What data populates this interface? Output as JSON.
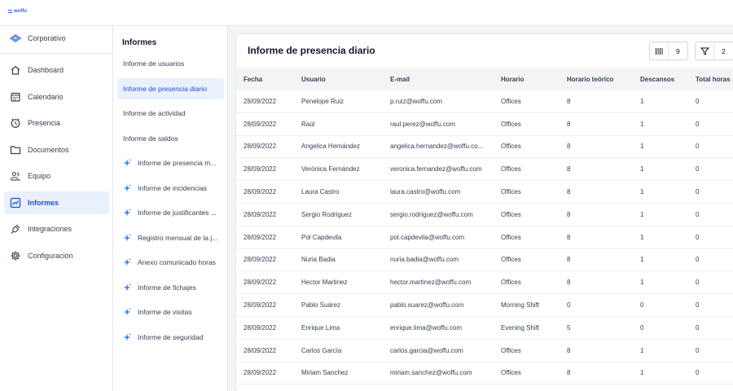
{
  "app": {
    "logo_text": "woffu"
  },
  "company": {
    "name": "Corporativo"
  },
  "nav": [
    {
      "label": "Dashboard",
      "icon": "home-icon"
    },
    {
      "label": "Calendario",
      "icon": "calendar-icon"
    },
    {
      "label": "Presencia",
      "icon": "clock-icon"
    },
    {
      "label": "Documentos",
      "icon": "folder-icon"
    },
    {
      "label": "Equipo",
      "icon": "team-icon"
    },
    {
      "label": "Informes",
      "icon": "chart-icon",
      "active": true
    },
    {
      "label": "Integraciones",
      "icon": "plug-icon"
    },
    {
      "label": "Configuración",
      "icon": "gear-icon"
    }
  ],
  "subnav": {
    "title": "Informes",
    "items": [
      {
        "label": "Informe de usuarios",
        "premium": false
      },
      {
        "label": "Informe de presencia diario",
        "premium": false,
        "active": true
      },
      {
        "label": "Informe de actividad",
        "premium": false
      },
      {
        "label": "Informe de saldos",
        "premium": false
      },
      {
        "label": "Informe de presencia m...",
        "premium": true
      },
      {
        "label": "Informe de incidencias",
        "premium": true
      },
      {
        "label": "Informe de justificantes ...",
        "premium": true
      },
      {
        "label": "Registro mensual de la j...",
        "premium": true
      },
      {
        "label": "Anexo comunicado horas",
        "premium": true
      },
      {
        "label": "Informe de fichajes",
        "premium": true
      },
      {
        "label": "Informe de visitas",
        "premium": true
      },
      {
        "label": "Informe de seguridad",
        "premium": true
      }
    ]
  },
  "report": {
    "title": "Informe de presencia diario",
    "columns_button_count": "9",
    "filter_button_count": "2"
  },
  "table": {
    "columns": [
      "Fecha",
      "Usuario",
      "E-mail",
      "Horario",
      "Horario teórico",
      "Descansos",
      "Total horas"
    ],
    "rows": [
      [
        "28/09/2022",
        "Penelope Ruiz",
        "p.ruiz@woffu.com",
        "Offices",
        "8",
        "1",
        "0"
      ],
      [
        "28/09/2022",
        "Raúl",
        "raul.perez@woffu.com",
        "Offices",
        "8",
        "1",
        "0"
      ],
      [
        "28/09/2022",
        "Angelica Hernández",
        "angelica.hernandez@woffu.co...",
        "Offices",
        "8",
        "1",
        "0"
      ],
      [
        "28/09/2022",
        "Verónica Fernández",
        "veronica.fernandez@woffu.com",
        "Offices",
        "8",
        "1",
        "0"
      ],
      [
        "28/09/2022",
        "Laura Castro",
        "laura.castro@woffu.com",
        "Offices",
        "8",
        "1",
        "0"
      ],
      [
        "28/09/2022",
        "Sergio Rodriguez",
        "sergio.rodriguez@woffu.com",
        "Offices",
        "8",
        "1",
        "0"
      ],
      [
        "28/09/2022",
        "Pol Capdevila",
        "pol.capdevila@woffu.com",
        "Offices",
        "8",
        "1",
        "0"
      ],
      [
        "28/09/2022",
        "Nuria Badia",
        "nuria.badia@woffu.com",
        "Offices",
        "8",
        "1",
        "0"
      ],
      [
        "28/09/2022",
        "Hector Martinez",
        "hector.martinez@woffu.com",
        "Offices",
        "8",
        "1",
        "0"
      ],
      [
        "28/09/2022",
        "Pablo Suárez",
        "pablo.suarez@woffu.com",
        "Morning Shift",
        "0",
        "0",
        "0"
      ],
      [
        "28/09/2022",
        "Enrique Lima",
        "enrique.lima@woffu.com",
        "Evening Shift",
        "5",
        "0",
        "0"
      ],
      [
        "28/09/2022",
        "Carlos García",
        "carlos.garcia@woffu.com",
        "Offices",
        "8",
        "1",
        "0"
      ],
      [
        "28/09/2022",
        "Miriam Sanchez",
        "miriam.sanchez@woffu.com",
        "Offices",
        "8",
        "1",
        "0"
      ]
    ]
  },
  "colors": {
    "accent": "#1d4ed8",
    "active_bg": "#eaf1fd",
    "premium_spark": "#3b82f6"
  }
}
